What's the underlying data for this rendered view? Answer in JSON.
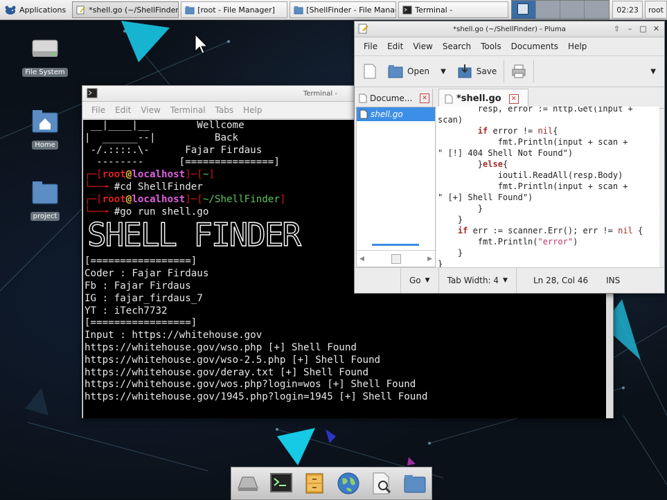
{
  "panel": {
    "applications_label": "Applications",
    "tasks": [
      {
        "label": "*shell.go (~/ShellFinder) - ",
        "icon": "text-editor-icon"
      },
      {
        "label": "[root - File Manager]",
        "icon": "folder-icon"
      },
      {
        "label": "[ShellFinder - File Manager]",
        "icon": "folder-icon"
      },
      {
        "label": "Terminal - ",
        "icon": "terminal-icon"
      }
    ],
    "clock": "02:23",
    "user": "root"
  },
  "desktop_icons": [
    {
      "label": "File System",
      "icon": "drive-icon"
    },
    {
      "label": "Home",
      "icon": "home-folder-icon"
    },
    {
      "label": "project",
      "icon": "folder-icon"
    }
  ],
  "terminal": {
    "title": "Terminal - ",
    "menu": [
      "File",
      "Edit",
      "View",
      "Terminal",
      "Tabs",
      "Help"
    ],
    "welcome_lines": [
      {
        "art": " __|____|__ ",
        "text": "       Wellcome"
      },
      {
        "art": "|  ______--|",
        "text": "          Back"
      },
      {
        "art": " -/.::::.\\- ",
        "text": "     Fajar Firdaus"
      },
      {
        "art": "  -------- ",
        "text": "     [===============]"
      }
    ],
    "prompt1": {
      "bracket_open": "┌─[",
      "user": "root",
      "at": "@",
      "host": "localhost",
      "bracket_close": "]─[",
      "path": "~",
      "end": "]"
    },
    "cmd1": {
      "prefix": "└──╼ ",
      "command": "#cd ShellFinder"
    },
    "prompt2": {
      "bracket_open": "┌─[",
      "user": "root",
      "at": "@",
      "host": "localhost",
      "bracket_close": "]─[",
      "path": "~/ShellFinder",
      "end": "]"
    },
    "cmd2": {
      "prefix": "└──╼ ",
      "command": "#go run shell.go"
    },
    "banner": "SHELL FINDER",
    "output": [
      "[=================]",
      "Coder : Fajar Firdaus",
      "Fb : Fajar Firdaus",
      "IG : fajar_firdaus_7",
      "YT : iTech7732",
      "[=================]",
      "Input : https://whitehouse.gov",
      "https://whitehouse.gov/wso.php [+] Shell Found",
      "https://whitehouse.gov/wso-2.5.php [+] Shell Found",
      "https://whitehouse.gov/deray.txt [+] Shell Found",
      "https://whitehouse.gov/wos.php?login=wos [+] Shell Found",
      "https://whitehouse.gov/1945.php?login=1945 [+] Shell Found"
    ]
  },
  "pluma": {
    "title": "*shell.go (~/ShellFinder) - Pluma",
    "menu": [
      "File",
      "Edit",
      "View",
      "Search",
      "Tools",
      "Documents",
      "Help"
    ],
    "toolbar": {
      "open": "Open",
      "save": "Save"
    },
    "side_tab": "Docume...",
    "doc_tab": "*shell.go",
    "side_items": [
      "shell.go"
    ],
    "code": {
      "l1": "        resp, error := http.Get(input +",
      "l2": "scan)",
      "l3_kw": "if",
      "l3a": " error != ",
      "l3_nil": "nil",
      "l3b": "{",
      "l4": "            fmt.Println(input + scan +",
      "l5": "\" [!] 404 Shell Not Found\")",
      "l6a": "        }",
      "l6_kw": "else",
      "l6b": "{",
      "l7": "            ioutil.ReadAll(resp.Body)",
      "l8": "            fmt.Println(input + scan +",
      "l9": "\" [+] Shell Found\")",
      "l10": "        }",
      "l11": "    }",
      "l12_kw": "if",
      "l12a": " err := scanner.Err(); err != ",
      "l12_nil": "nil",
      "l12b": " {",
      "l13a": "        fmt.Println(",
      "l13_str": "\"error\"",
      "l13b": ")",
      "l14": "    }",
      "l15": "}"
    },
    "status": {
      "lang": "Go",
      "tab_width": "Tab Width:  4",
      "position": "Ln 28, Col 46",
      "mode": "INS"
    }
  },
  "dock": [
    "drive-icon",
    "terminal-icon",
    "file-cabinet-icon",
    "web-browser-icon",
    "document-viewer-icon",
    "folder-icon"
  ]
}
